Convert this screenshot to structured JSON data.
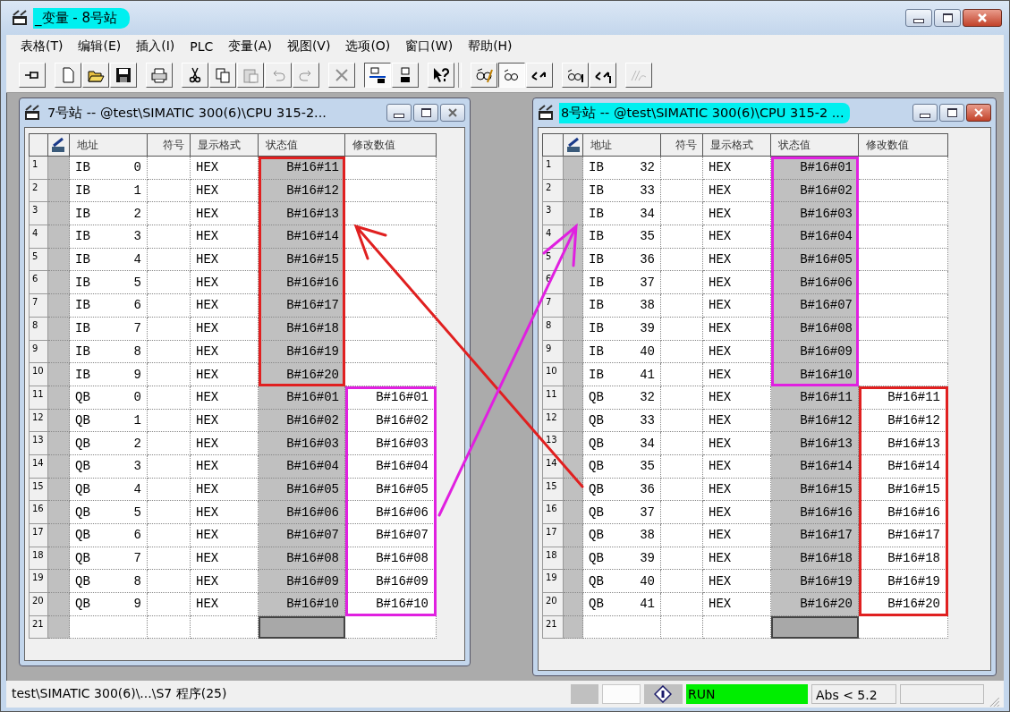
{
  "window": {
    "title": "_变量 - 8号站",
    "highlighted": true
  },
  "menu": [
    "表格(T)",
    "编辑(E)",
    "插入(I)",
    "PLC",
    "变量(A)",
    "视图(V)",
    "选项(O)",
    "窗口(W)",
    "帮助(H)"
  ],
  "toolbar": [
    [
      {
        "kind": "pin",
        "disabled": false,
        "pressed": false
      }
    ],
    [
      {
        "kind": "new",
        "disabled": false,
        "pressed": false
      },
      {
        "kind": "open",
        "disabled": false,
        "pressed": false
      },
      {
        "kind": "save",
        "disabled": false,
        "pressed": false
      }
    ],
    [
      {
        "kind": "print",
        "disabled": false,
        "pressed": false
      }
    ],
    [
      {
        "kind": "cut",
        "disabled": false,
        "pressed": false
      },
      {
        "kind": "copy",
        "disabled": false,
        "pressed": false
      },
      {
        "kind": "paste",
        "disabled": true,
        "pressed": false
      },
      {
        "kind": "undo",
        "disabled": true,
        "pressed": false
      },
      {
        "kind": "redo",
        "disabled": true,
        "pressed": false
      }
    ],
    [
      {
        "kind": "delete",
        "disabled": true,
        "pressed": false
      }
    ],
    [
      {
        "kind": "network",
        "disabled": false,
        "pressed": true
      },
      {
        "kind": "station",
        "disabled": false,
        "pressed": false
      }
    ],
    [
      {
        "kind": "help",
        "disabled": false,
        "pressed": false
      }
    ],
    [
      {
        "kind": "monitor",
        "disabled": false,
        "pressed": false
      },
      {
        "kind": "glasses",
        "disabled": false,
        "pressed": true
      },
      {
        "kind": "modify",
        "disabled": false,
        "pressed": false
      }
    ],
    [
      {
        "kind": "glasses-trigger",
        "disabled": false,
        "pressed": false
      },
      {
        "kind": "modify-trigger",
        "disabled": false,
        "pressed": false
      }
    ],
    [
      {
        "kind": "force",
        "disabled": true,
        "pressed": false
      }
    ]
  ],
  "child_windows": [
    {
      "title": "7号站 -- @test\\SIMATIC 300(6)\\CPU 315-2...",
      "highlighted": false,
      "close_red": false,
      "annotation_boxes": [
        {
          "color": "#e02020"
        },
        {
          "color": "#e020e0"
        }
      ],
      "columns": [
        "地址",
        "符号",
        "显示格式",
        "状态值",
        "修改数值"
      ],
      "rows": [
        {
          "num": "1",
          "operand": "IB",
          "address_no": "0",
          "format": "HEX",
          "status": "B#16#11",
          "focused": false
        },
        {
          "num": "2",
          "operand": "IB",
          "address_no": "1",
          "format": "HEX",
          "status": "B#16#12",
          "focused": false
        },
        {
          "num": "3",
          "operand": "IB",
          "address_no": "2",
          "format": "HEX",
          "status": "B#16#13",
          "focused": false
        },
        {
          "num": "4",
          "operand": "IB",
          "address_no": "3",
          "format": "HEX",
          "status": "B#16#14",
          "focused": false
        },
        {
          "num": "5",
          "operand": "IB",
          "address_no": "4",
          "format": "HEX",
          "status": "B#16#15",
          "focused": false
        },
        {
          "num": "6",
          "operand": "IB",
          "address_no": "5",
          "format": "HEX",
          "status": "B#16#16",
          "focused": false
        },
        {
          "num": "7",
          "operand": "IB",
          "address_no": "6",
          "format": "HEX",
          "status": "B#16#17",
          "focused": false
        },
        {
          "num": "8",
          "operand": "IB",
          "address_no": "7",
          "format": "HEX",
          "status": "B#16#18",
          "focused": false
        },
        {
          "num": "9",
          "operand": "IB",
          "address_no": "8",
          "format": "HEX",
          "status": "B#16#19",
          "focused": false
        },
        {
          "num": "10",
          "operand": "IB",
          "address_no": "9",
          "format": "HEX",
          "status": "B#16#20",
          "focused": false
        },
        {
          "num": "11",
          "operand": "QB",
          "address_no": "0",
          "format": "HEX",
          "status": "B#16#01",
          "modify": "B#16#01",
          "focused": false
        },
        {
          "num": "12",
          "operand": "QB",
          "address_no": "1",
          "format": "HEX",
          "status": "B#16#02",
          "modify": "B#16#02",
          "focused": false
        },
        {
          "num": "13",
          "operand": "QB",
          "address_no": "2",
          "format": "HEX",
          "status": "B#16#03",
          "modify": "B#16#03",
          "focused": false
        },
        {
          "num": "14",
          "operand": "QB",
          "address_no": "3",
          "format": "HEX",
          "status": "B#16#04",
          "modify": "B#16#04",
          "focused": false
        },
        {
          "num": "15",
          "operand": "QB",
          "address_no": "4",
          "format": "HEX",
          "status": "B#16#05",
          "modify": "B#16#05",
          "focused": false
        },
        {
          "num": "16",
          "operand": "QB",
          "address_no": "5",
          "format": "HEX",
          "status": "B#16#06",
          "modify": "B#16#06",
          "focused": false
        },
        {
          "num": "17",
          "operand": "QB",
          "address_no": "6",
          "format": "HEX",
          "status": "B#16#07",
          "modify": "B#16#07",
          "focused": false
        },
        {
          "num": "18",
          "operand": "QB",
          "address_no": "7",
          "format": "HEX",
          "status": "B#16#08",
          "modify": "B#16#08",
          "focused": false
        },
        {
          "num": "19",
          "operand": "QB",
          "address_no": "8",
          "format": "HEX",
          "status": "B#16#09",
          "modify": "B#16#09",
          "focused": false
        },
        {
          "num": "20",
          "operand": "QB",
          "address_no": "9",
          "format": "HEX",
          "status": "B#16#10",
          "modify": "B#16#10",
          "focused": false
        },
        {
          "num": "21",
          "focused": true
        }
      ]
    },
    {
      "title": "8号站 -- @test\\SIMATIC 300(6)\\CPU 315-2 ...",
      "highlighted": true,
      "close_red": true,
      "annotation_boxes": [
        {
          "color": "#e020e0"
        },
        {
          "color": "#e02020"
        }
      ],
      "columns": [
        "地址",
        "符号",
        "显示格式",
        "状态值",
        "修改数值"
      ],
      "rows": [
        {
          "num": "1",
          "operand": "IB",
          "address_no": "32",
          "format": "HEX",
          "status": "B#16#01",
          "focused": false
        },
        {
          "num": "2",
          "operand": "IB",
          "address_no": "33",
          "format": "HEX",
          "status": "B#16#02",
          "focused": false
        },
        {
          "num": "3",
          "operand": "IB",
          "address_no": "34",
          "format": "HEX",
          "status": "B#16#03",
          "focused": false
        },
        {
          "num": "4",
          "operand": "IB",
          "address_no": "35",
          "format": "HEX",
          "status": "B#16#04",
          "focused": false
        },
        {
          "num": "5",
          "operand": "IB",
          "address_no": "36",
          "format": "HEX",
          "status": "B#16#05",
          "focused": false
        },
        {
          "num": "6",
          "operand": "IB",
          "address_no": "37",
          "format": "HEX",
          "status": "B#16#06",
          "focused": false
        },
        {
          "num": "7",
          "operand": "IB",
          "address_no": "38",
          "format": "HEX",
          "status": "B#16#07",
          "focused": false
        },
        {
          "num": "8",
          "operand": "IB",
          "address_no": "39",
          "format": "HEX",
          "status": "B#16#08",
          "focused": false
        },
        {
          "num": "9",
          "operand": "IB",
          "address_no": "40",
          "format": "HEX",
          "status": "B#16#09",
          "focused": false
        },
        {
          "num": "10",
          "operand": "IB",
          "address_no": "41",
          "format": "HEX",
          "status": "B#16#10",
          "focused": false
        },
        {
          "num": "11",
          "operand": "QB",
          "address_no": "32",
          "format": "HEX",
          "status": "B#16#11",
          "modify": "B#16#11",
          "focused": false
        },
        {
          "num": "12",
          "operand": "QB",
          "address_no": "33",
          "format": "HEX",
          "status": "B#16#12",
          "modify": "B#16#12",
          "focused": false
        },
        {
          "num": "13",
          "operand": "QB",
          "address_no": "34",
          "format": "HEX",
          "status": "B#16#13",
          "modify": "B#16#13",
          "focused": false
        },
        {
          "num": "14",
          "operand": "QB",
          "address_no": "35",
          "format": "HEX",
          "status": "B#16#14",
          "modify": "B#16#14",
          "focused": false
        },
        {
          "num": "15",
          "operand": "QB",
          "address_no": "36",
          "format": "HEX",
          "status": "B#16#15",
          "modify": "B#16#15",
          "focused": false
        },
        {
          "num": "16",
          "operand": "QB",
          "address_no": "37",
          "format": "HEX",
          "status": "B#16#16",
          "modify": "B#16#16",
          "focused": false
        },
        {
          "num": "17",
          "operand": "QB",
          "address_no": "38",
          "format": "HEX",
          "status": "B#16#17",
          "modify": "B#16#17",
          "focused": false
        },
        {
          "num": "18",
          "operand": "QB",
          "address_no": "39",
          "format": "HEX",
          "status": "B#16#18",
          "modify": "B#16#18",
          "focused": false
        },
        {
          "num": "19",
          "operand": "QB",
          "address_no": "40",
          "format": "HEX",
          "status": "B#16#19",
          "modify": "B#16#19",
          "focused": false
        },
        {
          "num": "20",
          "operand": "QB",
          "address_no": "41",
          "format": "HEX",
          "status": "B#16#20",
          "modify": "B#16#20",
          "focused": false
        },
        {
          "num": "21",
          "focused": true
        }
      ]
    }
  ],
  "annotation_arrows": [
    {
      "color": "#e02020"
    },
    {
      "color": "#e020e0"
    }
  ],
  "status_bar": {
    "path": "test\\SIMATIC 300(6)\\...\\S7 程序(25)",
    "mode": "RUN",
    "running": true,
    "condition": "Abs < 5.2"
  }
}
